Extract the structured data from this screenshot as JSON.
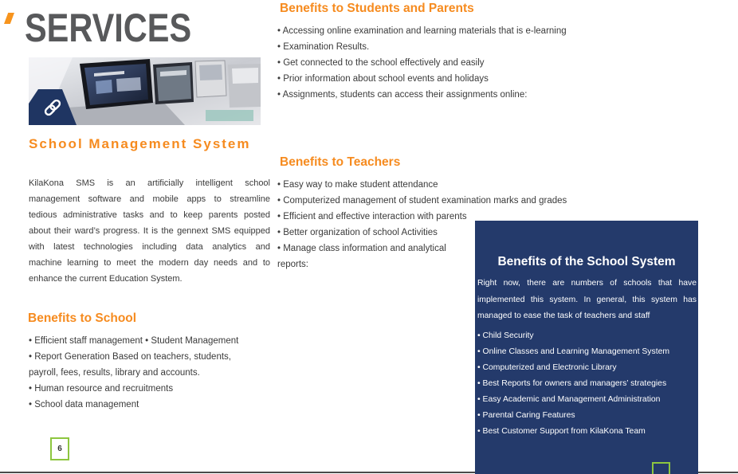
{
  "header": {
    "title": "SERVICES"
  },
  "colors": {
    "orange": "#f68b1f",
    "accent": "#f7941d",
    "navy": "#243a6b",
    "green": "#8dc63f",
    "text": "#3a3a3a",
    "title": "#58595b"
  },
  "hero_image": {
    "badge_icon": "link-icon"
  },
  "sms": {
    "heading": "School Management System",
    "description_lines": [
      "KilaKona SMS is an artificially intelligent school",
      "management software and mobile apps to streamline",
      "tedious administrative tasks and to keep parents posted",
      "about their ward’s progress. It is the gennext SMS equipped",
      "with latest technologies including data analytics and",
      "machine learning to meet the modern day needs and to",
      "enhance the current Education System."
    ]
  },
  "school_benefits": {
    "heading": "Benefits to School",
    "items": [
      "• Efficient staff management • Student Management",
      "• Report Generation Based on teachers, students, payroll, fees, results, library and accounts.",
      "• Human resource and recruitments",
      "• School data management"
    ]
  },
  "students_parents_benefits": {
    "heading": "Benefits to Students and Parents",
    "items": [
      "• Accessing online examination and learning materials that is e-learning",
      "• Examination Results.",
      "• Get connected to the school effectively and easily",
      "• Prior information about school events and holidays",
      "• Assignments, students can access their assignments online:"
    ]
  },
  "teacher_benefits": {
    "heading": "Benefits to Teachers",
    "items": [
      "• Easy way to make student attendance",
      "• Computerized management of student examination marks and grades",
      "• Efficient and effective interaction with parents",
      "• Better organization of school Activities",
      "• Manage class information and analytical reports:"
    ]
  },
  "school_system": {
    "heading": "Benefits of the School System",
    "intro_lines": [
      "Right now, there are numbers of schools that have",
      "implemented this system. In general, this system has",
      "managed to ease the task of teachers and staff"
    ],
    "items": [
      "• Child Security",
      "• Online Classes and Learning Management System",
      "• Computerized and Electronic Library",
      "• Best Reports for owners and managers’ strategies",
      "• Easy Academic and Management Administration",
      "• Parental Caring Features",
      "• Best Customer Support from KilaKona Team"
    ]
  },
  "page": {
    "number": "6"
  }
}
